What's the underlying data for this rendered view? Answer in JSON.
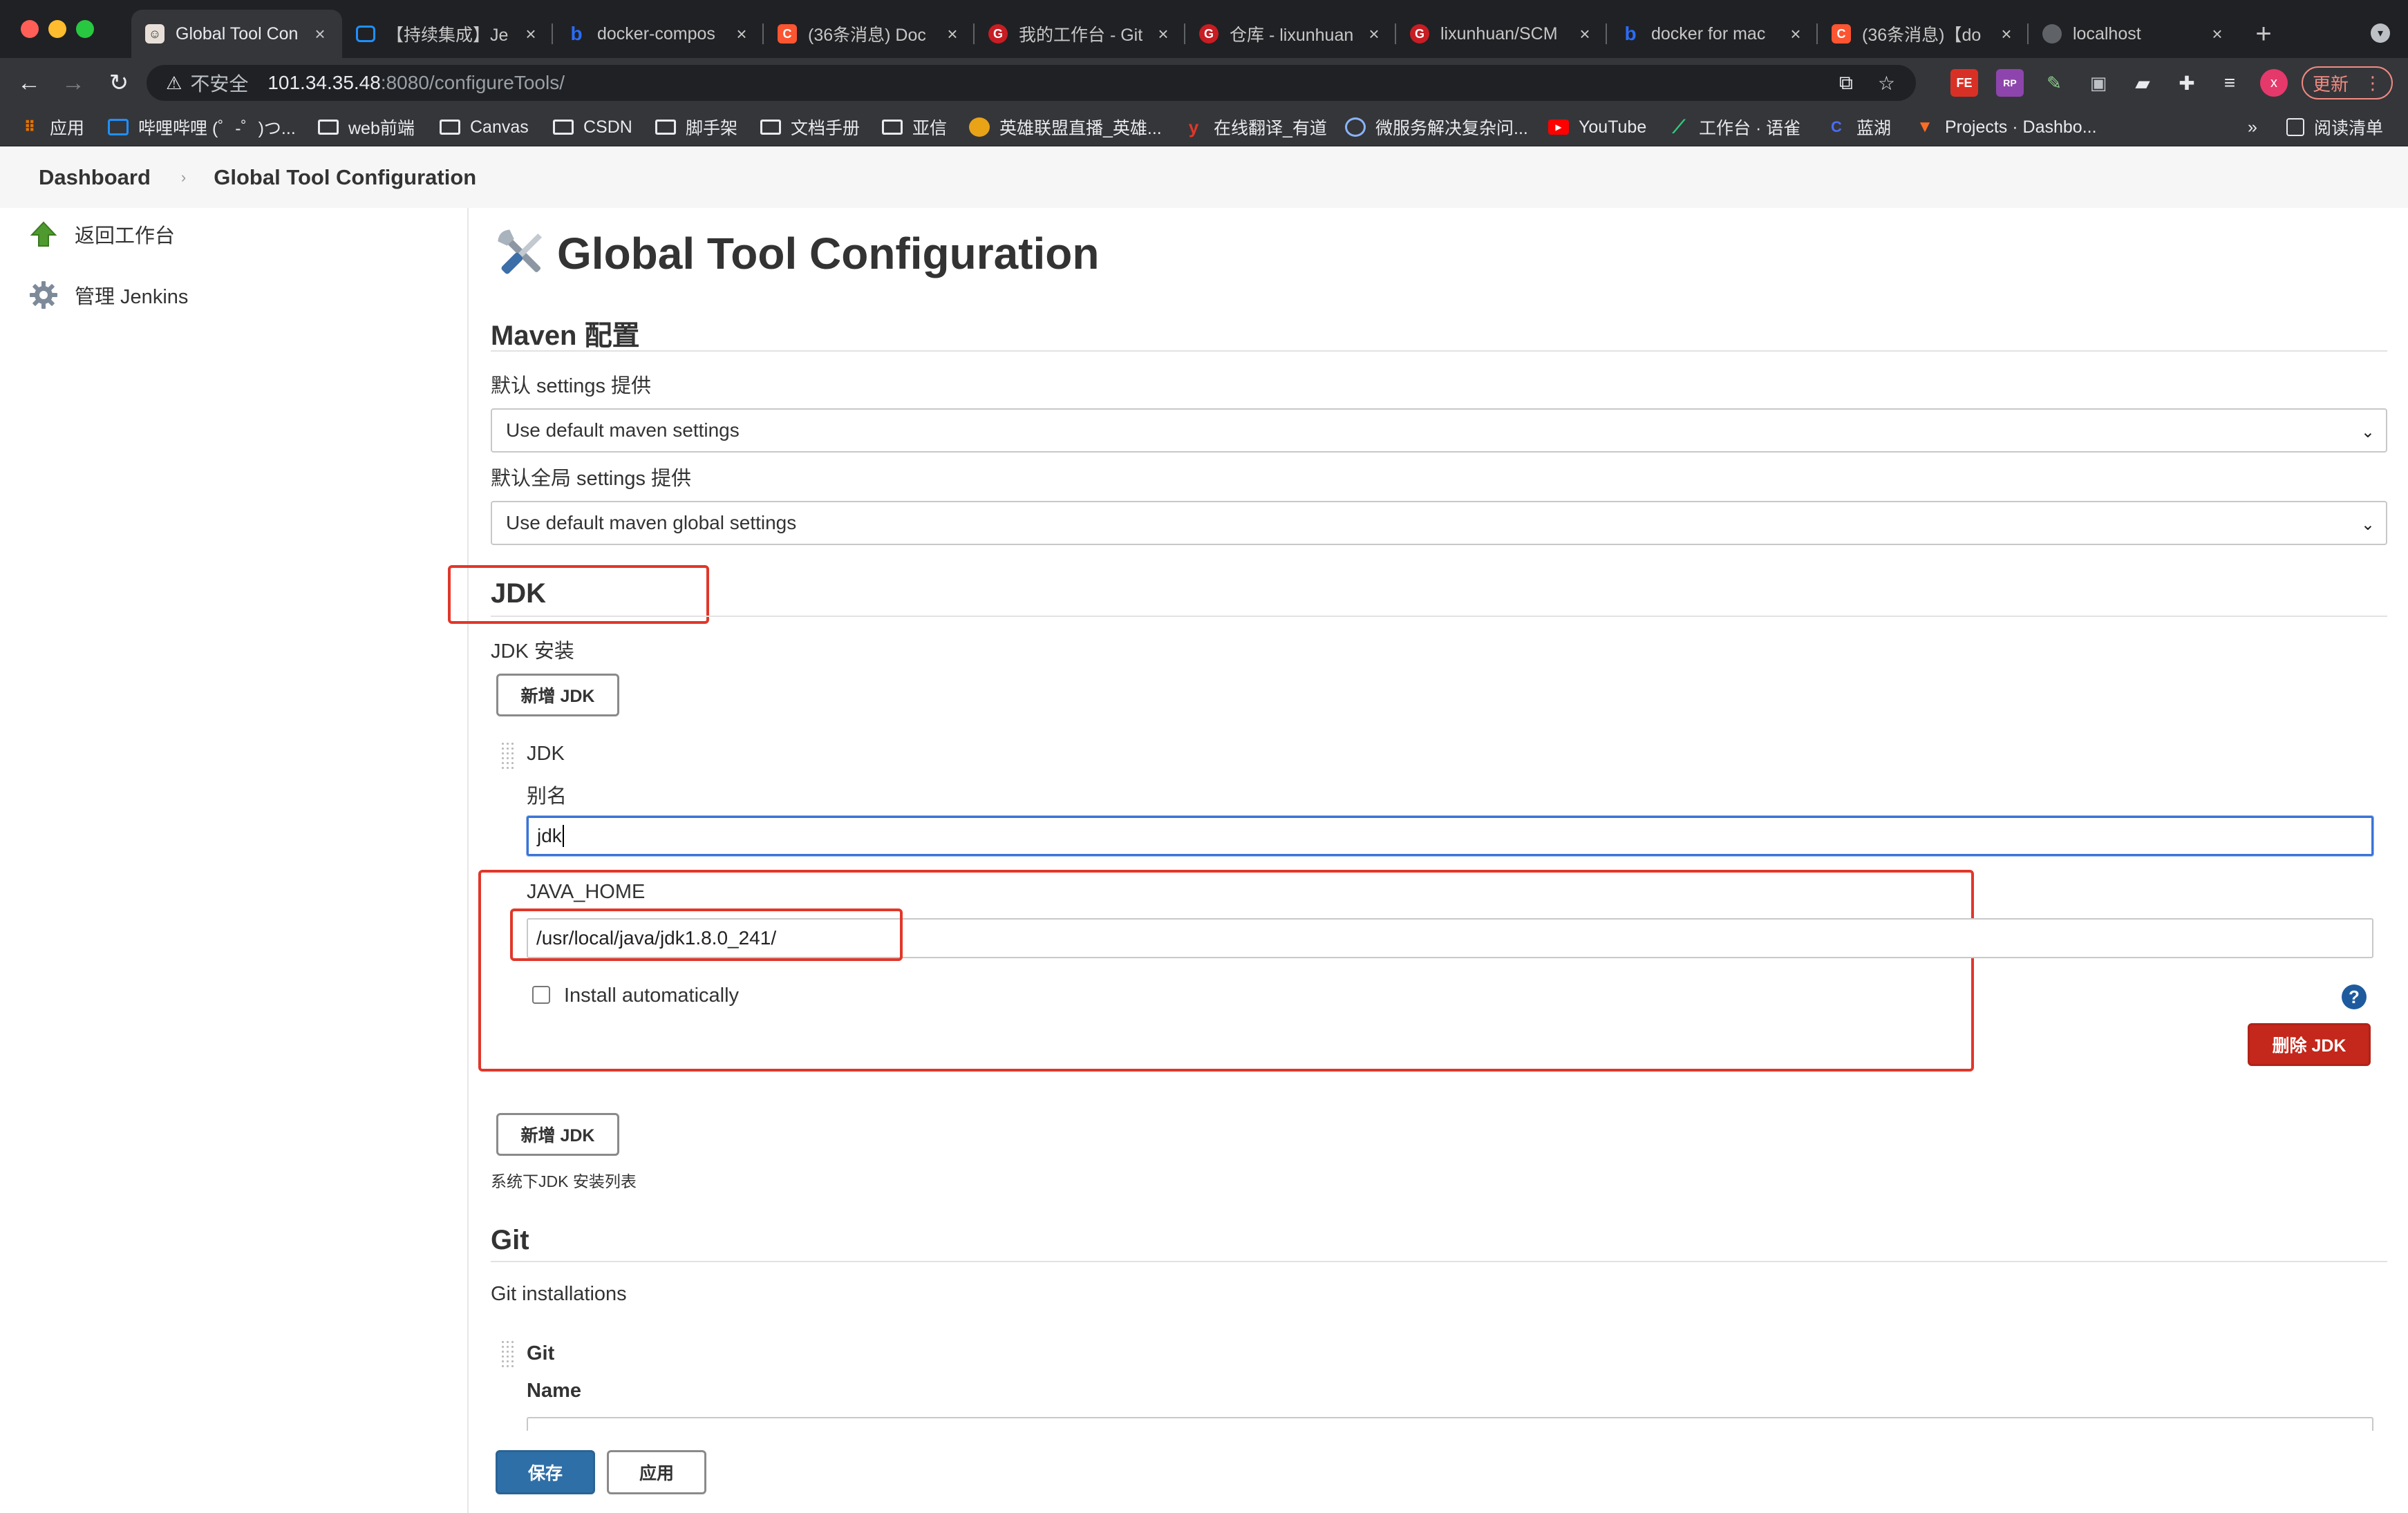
{
  "browser": {
    "tabs": [
      {
        "title": "Global Tool Con",
        "active": true,
        "icon": "jenkins-favicon",
        "color": "#cfcfcf"
      },
      {
        "title": "【持续集成】Je",
        "active": false,
        "icon": "bilibili-favicon",
        "color": "#1e90ff"
      },
      {
        "title": "docker-compos",
        "active": false,
        "icon": "bing-favicon",
        "color": "#2b6cf7"
      },
      {
        "title": "(36条消息) Doc",
        "active": false,
        "icon": "csdn-favicon",
        "color": "#fc5531"
      },
      {
        "title": "我的工作台 - Git",
        "active": false,
        "icon": "gitee-favicon",
        "color": "#c71d23"
      },
      {
        "title": "仓库 - lixunhuan",
        "active": false,
        "icon": "gitee-favicon",
        "color": "#c71d23"
      },
      {
        "title": "lixunhuan/SCM",
        "active": false,
        "icon": "gitee-favicon",
        "color": "#c71d23"
      },
      {
        "title": "docker for mac",
        "active": false,
        "icon": "bing-favicon",
        "color": "#2b6cf7"
      },
      {
        "title": "(36条消息)【do",
        "active": false,
        "icon": "csdn-favicon",
        "color": "#fc5531"
      },
      {
        "title": "localhost",
        "active": false,
        "icon": "globe-favicon",
        "color": "#9aa0a6"
      }
    ],
    "tab_close": "×",
    "new_tab": "+",
    "address": {
      "insecure_label": "不安全",
      "host": "101.34.35.48",
      "path": ":8080/configureTools/"
    },
    "avatar_letter": "x",
    "update_label": "更新",
    "bookmarks": [
      {
        "label": "应用",
        "icon": "apps-grid-icon"
      },
      {
        "label": "哔哩哔哩 (゜-゜)つ...",
        "icon": "bilibili-icon"
      },
      {
        "label": "web前端",
        "icon": "folder-icon"
      },
      {
        "label": "Canvas",
        "icon": "folder-icon"
      },
      {
        "label": "CSDN",
        "icon": "folder-icon"
      },
      {
        "label": "脚手架",
        "icon": "folder-icon"
      },
      {
        "label": "文档手册",
        "icon": "folder-icon"
      },
      {
        "label": "亚信",
        "icon": "folder-icon"
      },
      {
        "label": "英雄联盟直播_英雄...",
        "icon": "lol-icon"
      },
      {
        "label": "在线翻译_有道",
        "icon": "youdao-icon"
      },
      {
        "label": "微服务解决复杂问...",
        "icon": "browser-icon"
      },
      {
        "label": "YouTube",
        "icon": "youtube-icon"
      },
      {
        "label": "工作台 · 语雀",
        "icon": "yuque-icon"
      },
      {
        "label": "蓝湖",
        "icon": "lanhu-icon"
      },
      {
        "label": "Projects · Dashbo...",
        "icon": "gitlab-icon"
      }
    ],
    "bookmarks_more": "»",
    "reading_list": "阅读清单"
  },
  "breadcrumb": {
    "items": [
      "Dashboard",
      "Global Tool Configuration"
    ],
    "separator": "›"
  },
  "sidebar": {
    "items": [
      {
        "label": "返回工作台",
        "icon": "up-arrow-icon"
      },
      {
        "label": "管理 Jenkins",
        "icon": "gear-icon"
      }
    ]
  },
  "main": {
    "title": "Global Tool Configuration",
    "maven": {
      "heading": "Maven 配置",
      "settings_label": "默认 settings 提供",
      "settings_value": "Use default maven settings",
      "global_settings_label": "默认全局 settings 提供",
      "global_settings_value": "Use default maven global settings"
    },
    "jdk": {
      "heading": "JDK",
      "installations_label": "JDK 安装",
      "add_button": "新增 JDK",
      "item_title": "JDK",
      "alias_label": "别名",
      "alias_value": "jdk",
      "java_home_label": "JAVA_HOME",
      "java_home_value": "/usr/local/java/jdk1.8.0_241/",
      "install_auto_label": "Install automatically",
      "install_auto_checked": false,
      "help_icon": "?",
      "delete_button": "删除 JDK",
      "add_button_bottom": "新增 JDK",
      "list_note": "系统下JDK 安装列表"
    },
    "git": {
      "heading": "Git",
      "installations_label": "Git installations",
      "item_title": "Git",
      "name_label": "Name"
    },
    "footer": {
      "save_button": "保存",
      "apply_button": "应用"
    }
  },
  "colors": {
    "annotation_red": "#e1372a",
    "primary_blue": "#2f6fa7",
    "danger_red": "#c4271b",
    "focus_blue": "#3b73d6"
  }
}
